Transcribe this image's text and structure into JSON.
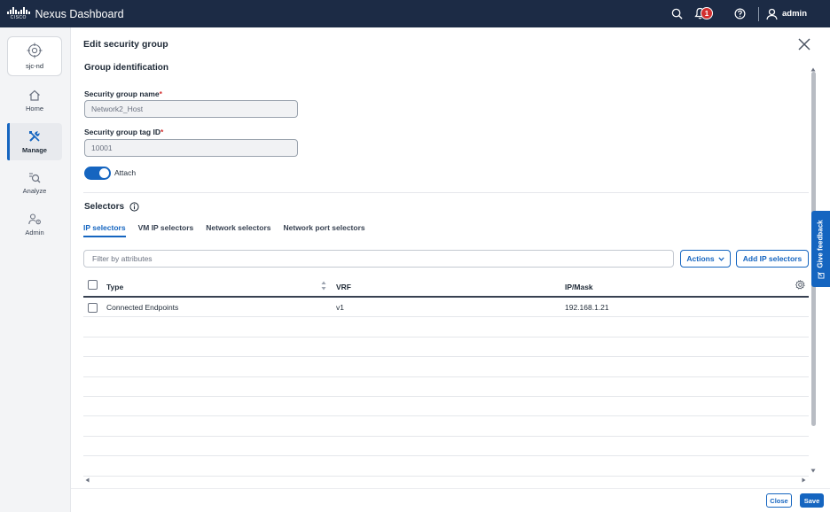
{
  "app": {
    "brand_small": "CISCO",
    "title": "Nexus Dashboard",
    "notification_count": "1",
    "user": "admin"
  },
  "sidebar": {
    "site": "sjc-nd",
    "items": [
      {
        "label": "Home",
        "icon": "home-icon"
      },
      {
        "label": "Manage",
        "icon": "tools-icon",
        "active": true
      },
      {
        "label": "Analyze",
        "icon": "analyze-icon"
      },
      {
        "label": "Admin",
        "icon": "admin-icon"
      }
    ]
  },
  "panel": {
    "title": "Edit security group",
    "section_title": "Group identification",
    "name_label": "Security group name",
    "name_value": "Network2_Host",
    "tag_label": "Security group tag ID",
    "tag_value": "10001",
    "required_mark": "*",
    "toggle_label": "Attach",
    "toggle_on": true,
    "selectors_title": "Selectors"
  },
  "tabs": [
    "IP selectors",
    "VM IP selectors",
    "Network selectors",
    "Network port selectors"
  ],
  "toolbar": {
    "filter_placeholder": "Filter by attributes",
    "actions_label": "Actions",
    "add_label": "Add IP selectors"
  },
  "table": {
    "columns": [
      "Type",
      "VRF",
      "IP/Mask"
    ],
    "rows": [
      {
        "type": "Connected Endpoints",
        "vrf": "v1",
        "ip_mask": "192.168.1.21"
      }
    ]
  },
  "footer": {
    "close_label": "Close",
    "save_label": "Save"
  },
  "feedback_label": "Give feedback",
  "colors": {
    "topbar": "#1c2b45",
    "accent": "#1565c0",
    "badge": "#d32f2f"
  }
}
